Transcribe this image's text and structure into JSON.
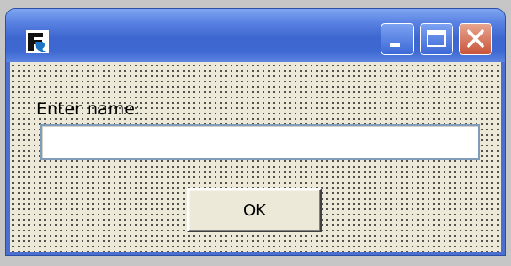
{
  "window": {
    "app_icon": "fr-logo-icon",
    "controls": {
      "minimize_icon": "minimize-icon",
      "maximize_icon": "maximize-icon",
      "close_icon": "close-icon"
    },
    "colors": {
      "titlebar": "#3d67cf",
      "close_button": "#c9553a",
      "client_background": "#ece9d8"
    }
  },
  "form": {
    "name_label": "Enter name:",
    "name_value": "",
    "ok_label": "OK"
  }
}
